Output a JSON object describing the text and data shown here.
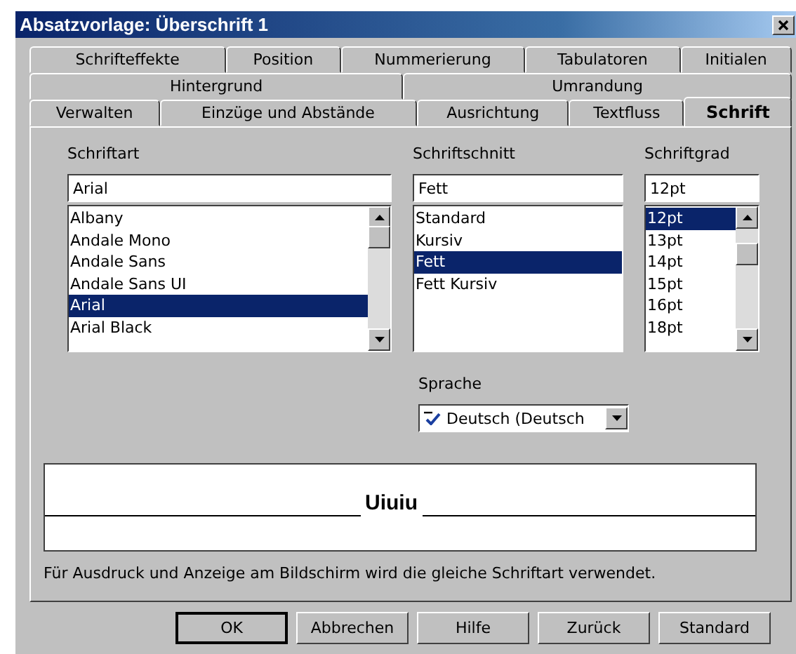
{
  "window": {
    "title": "Absatzvorlage: Überschrift 1"
  },
  "tab_rows": [
    [
      {
        "label": "Schrifteffekte",
        "selected": false
      },
      {
        "label": "Position",
        "selected": false
      },
      {
        "label": "Nummerierung",
        "selected": false
      },
      {
        "label": "Tabulatoren",
        "selected": false
      },
      {
        "label": "Initialen",
        "selected": false
      }
    ],
    [
      {
        "label": "Hintergrund",
        "selected": false
      },
      {
        "label": "Umrandung",
        "selected": false
      }
    ],
    [
      {
        "label": "Verwalten",
        "selected": false
      },
      {
        "label": "Einzüge und Abstände",
        "selected": false
      },
      {
        "label": "Ausrichtung",
        "selected": false
      },
      {
        "label": "Textfluss",
        "selected": false
      },
      {
        "label": "Schrift",
        "selected": true
      }
    ]
  ],
  "font_family": {
    "label": "Schriftart",
    "value": "Arial",
    "items": [
      {
        "label": "Albany",
        "selected": false
      },
      {
        "label": "Andale Mono",
        "selected": false
      },
      {
        "label": "Andale Sans",
        "selected": false
      },
      {
        "label": "Andale Sans UI",
        "selected": false
      },
      {
        "label": "Arial",
        "selected": true
      },
      {
        "label": "Arial Black",
        "selected": false
      }
    ]
  },
  "typeface": {
    "label": "Schriftschnitt",
    "value": "Fett",
    "items": [
      {
        "label": "Standard",
        "selected": false
      },
      {
        "label": "Kursiv",
        "selected": false
      },
      {
        "label": "Fett",
        "selected": true
      },
      {
        "label": "Fett Kursiv",
        "selected": false
      }
    ]
  },
  "size": {
    "label": "Schriftgrad",
    "value": "12pt",
    "items": [
      {
        "label": "12pt",
        "selected": true
      },
      {
        "label": "13pt",
        "selected": false
      },
      {
        "label": "14pt",
        "selected": false
      },
      {
        "label": "15pt",
        "selected": false
      },
      {
        "label": "16pt",
        "selected": false
      },
      {
        "label": "18pt",
        "selected": false
      }
    ]
  },
  "language": {
    "label": "Sprache",
    "value": "Deutsch (Deutsch"
  },
  "preview": {
    "text": "Uiuiu"
  },
  "note": "Für Ausdruck und Anzeige am Bildschirm wird die gleiche Schriftart verwendet.",
  "buttons": [
    {
      "label": "OK",
      "default": true
    },
    {
      "label": "Abbrechen",
      "default": false
    },
    {
      "label": "Hilfe",
      "default": false
    },
    {
      "label": "Zurück",
      "default": false
    },
    {
      "label": "Standard",
      "default": false
    }
  ]
}
